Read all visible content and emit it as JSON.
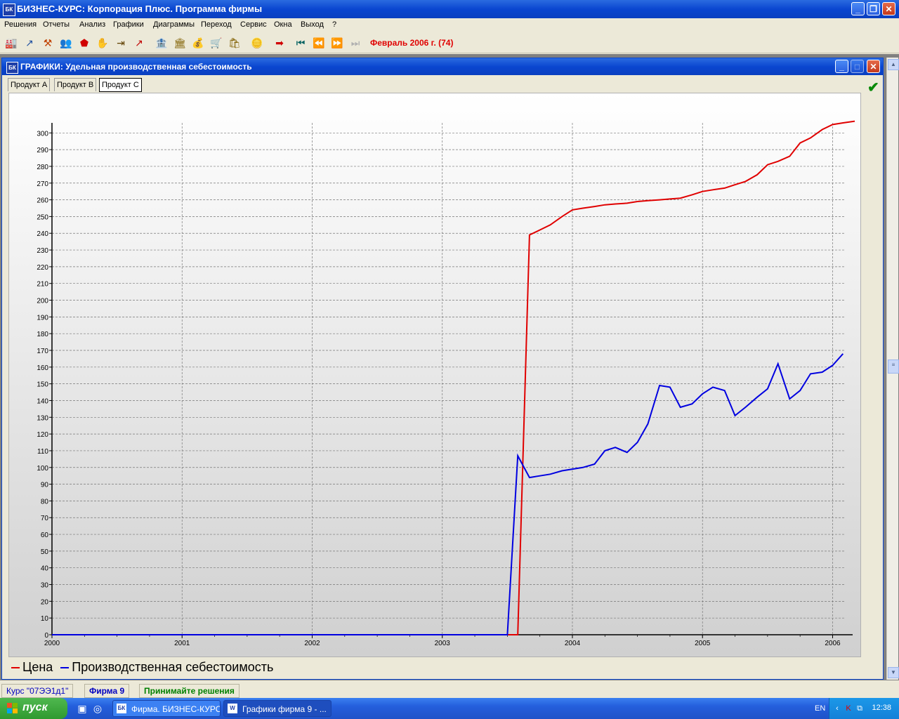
{
  "window": {
    "icon_text": "БК",
    "title": "БИЗНЕС-КУРС: Корпорация Плюс. Программа фирмы"
  },
  "menu": [
    "Решения",
    "Отчеты",
    "Анализ",
    "Графики",
    "Диаграммы",
    "Переход",
    "Сервис",
    "Окна",
    "Выход",
    "?"
  ],
  "toolbar": {
    "date_label": "Февраль 2006 г. (74)"
  },
  "child_window": {
    "title": "ГРАФИКИ: Удельная производственная себестоимость",
    "tabs": [
      "Продукт A",
      "Продукт B",
      "Продукт C"
    ],
    "active_tab": 2
  },
  "legend": {
    "red_label": "Цена",
    "blue_label": "Производственная себестоимость"
  },
  "chart_data": {
    "type": "line",
    "xlabel": "",
    "ylabel": "",
    "xlim": [
      2000.0,
      2006.08
    ],
    "ylim": [
      0,
      305
    ],
    "x_ticks": [
      "2000",
      "2001",
      "2002",
      "2003",
      "2004",
      "2005",
      "2006"
    ],
    "y_ticks": [
      0,
      10,
      20,
      30,
      40,
      50,
      60,
      70,
      80,
      90,
      100,
      110,
      120,
      130,
      140,
      150,
      160,
      170,
      180,
      190,
      200,
      210,
      220,
      230,
      240,
      250,
      260,
      270,
      280,
      290,
      300
    ],
    "grid": true,
    "legend_position": "bottom-left",
    "series": [
      {
        "name": "Цена",
        "color": "#E00000",
        "points": [
          [
            2000.0,
            0
          ],
          [
            2003.58,
            0
          ],
          [
            2003.67,
            239
          ],
          [
            2003.75,
            242
          ],
          [
            2003.83,
            245
          ],
          [
            2003.92,
            250
          ],
          [
            2004.0,
            254
          ],
          [
            2004.08,
            255
          ],
          [
            2004.17,
            256
          ],
          [
            2004.25,
            257
          ],
          [
            2004.33,
            257.5
          ],
          [
            2004.42,
            258
          ],
          [
            2004.5,
            259
          ],
          [
            2004.58,
            259.5
          ],
          [
            2004.67,
            260
          ],
          [
            2004.75,
            260.5
          ],
          [
            2004.83,
            261
          ],
          [
            2004.92,
            263
          ],
          [
            2005.0,
            265
          ],
          [
            2005.08,
            266
          ],
          [
            2005.17,
            267
          ],
          [
            2005.25,
            269
          ],
          [
            2005.33,
            271
          ],
          [
            2005.42,
            275
          ],
          [
            2005.5,
            281
          ],
          [
            2005.58,
            283
          ],
          [
            2005.67,
            286
          ],
          [
            2005.75,
            294
          ],
          [
            2005.83,
            297
          ],
          [
            2005.92,
            302
          ],
          [
            2006.0,
            305
          ],
          [
            2006.08,
            306
          ],
          [
            2006.17,
            307
          ]
        ]
      },
      {
        "name": "Производственная себестоимость",
        "color": "#0000E0",
        "points": [
          [
            2000.0,
            0
          ],
          [
            2003.5,
            0
          ],
          [
            2003.58,
            107
          ],
          [
            2003.67,
            94
          ],
          [
            2003.75,
            95
          ],
          [
            2003.83,
            96
          ],
          [
            2003.92,
            98
          ],
          [
            2004.0,
            99
          ],
          [
            2004.08,
            100
          ],
          [
            2004.17,
            102
          ],
          [
            2004.25,
            110
          ],
          [
            2004.33,
            112
          ],
          [
            2004.42,
            109
          ],
          [
            2004.5,
            115
          ],
          [
            2004.58,
            126
          ],
          [
            2004.67,
            149
          ],
          [
            2004.75,
            148
          ],
          [
            2004.83,
            136
          ],
          [
            2004.92,
            138
          ],
          [
            2005.0,
            144
          ],
          [
            2005.08,
            148
          ],
          [
            2005.17,
            146
          ],
          [
            2005.25,
            131
          ],
          [
            2005.33,
            136
          ],
          [
            2005.42,
            142
          ],
          [
            2005.5,
            147
          ],
          [
            2005.58,
            162
          ],
          [
            2005.67,
            141
          ],
          [
            2005.75,
            146
          ],
          [
            2005.83,
            156
          ],
          [
            2005.92,
            157
          ],
          [
            2006.0,
            161
          ],
          [
            2006.08,
            168
          ]
        ]
      }
    ]
  },
  "statusbar": {
    "course": "Курс \"07ЭЭ1д1\"",
    "firm": "Фирма 9",
    "hint": "Принимайте решения"
  },
  "taskbar": {
    "start_label": "пуск",
    "tasks": [
      "Фирма. БИЗНЕС-КУРС",
      "Графики фирма 9 - ..."
    ],
    "language": "EN",
    "clock": "12:38"
  }
}
